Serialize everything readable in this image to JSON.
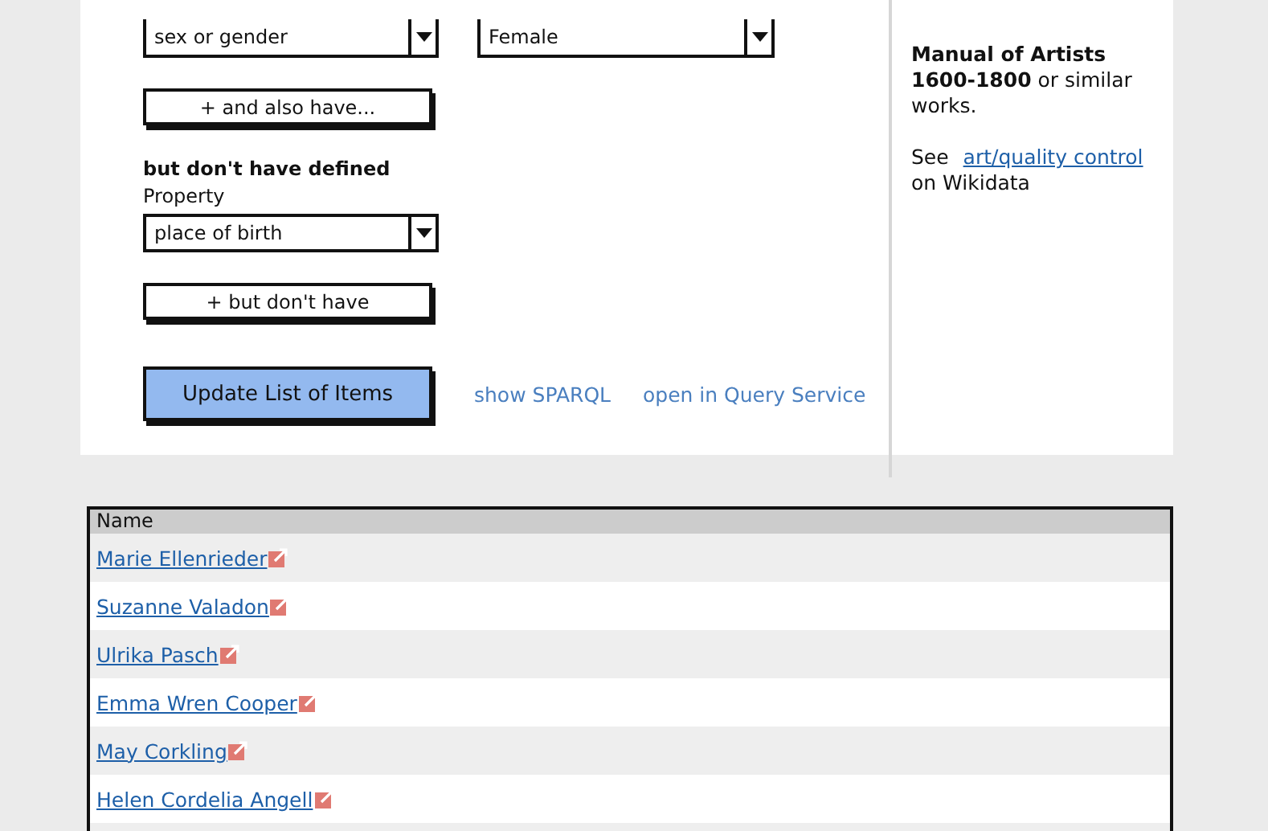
{
  "query_form": {
    "has_property": {
      "property": "sex or gender",
      "value": "Female"
    },
    "add_have_button": "+ and also have...",
    "missing_heading": "but don't have defined",
    "missing_label": "Property",
    "missing_property": "place of birth",
    "add_missing_button": "+ but don't have",
    "update_button": "Update List of Items",
    "links": [
      "show SPARQL",
      "open in Query Service"
    ]
  },
  "sidebar": {
    "note": "**Manual of Artists 1600-1800** or similar works.",
    "see_prefix": "See",
    "see_link": "art/quality control",
    "see_suffix": "on Wikidata"
  },
  "table": {
    "columns": [
      "Name"
    ],
    "rows": [
      {
        "name": "Marie Ellenrieder"
      },
      {
        "name": "Suzanne Valadon"
      },
      {
        "name": "Ulrika Pasch"
      },
      {
        "name": "Emma Wren Cooper"
      },
      {
        "name": "May Corkling"
      },
      {
        "name": "Helen Cordelia Angell"
      }
    ]
  }
}
